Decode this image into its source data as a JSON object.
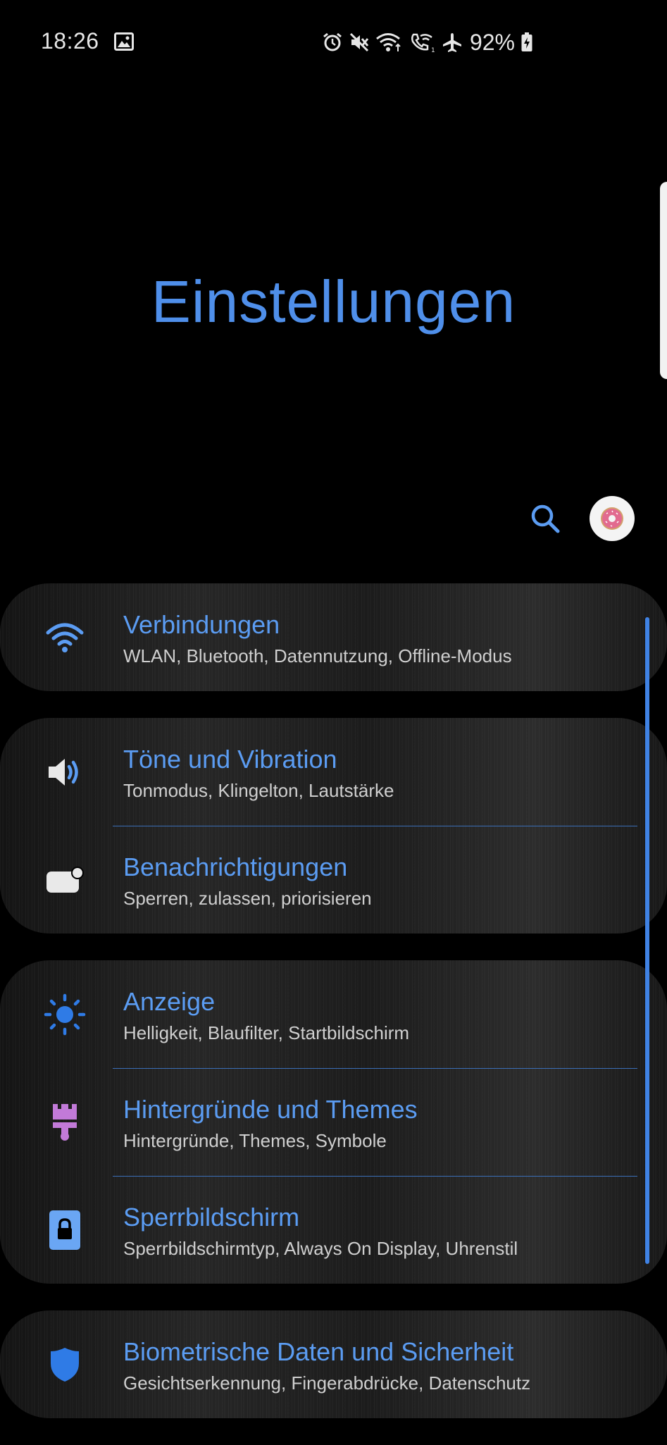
{
  "status_bar": {
    "time": "18:26",
    "battery_percent": "92%",
    "icons": [
      "image-icon",
      "alarm-icon",
      "mute-icon",
      "wifi-icon",
      "wifi-call-icon",
      "airplane-icon",
      "battery-charging-icon"
    ]
  },
  "header": {
    "title": "Einstellungen"
  },
  "colors": {
    "accent": "#5b9cf2",
    "background": "#000000",
    "divider": "#3b6fb8",
    "themes_icon": "#c27ad8"
  },
  "settings": {
    "connections": {
      "title": "Verbindungen",
      "subtitle": "WLAN, Bluetooth, Datennutzung, Offline-Modus",
      "icon": "wifi-icon"
    },
    "sounds": {
      "title": "Töne und Vibration",
      "subtitle": "Tonmodus, Klingelton, Lautstärke",
      "icon": "speaker-icon"
    },
    "notifications": {
      "title": "Benachrichtigungen",
      "subtitle": "Sperren, zulassen, priorisieren",
      "icon": "notification-icon"
    },
    "display": {
      "title": "Anzeige",
      "subtitle": "Helligkeit, Blaufilter, Startbildschirm",
      "icon": "brightness-icon"
    },
    "themes": {
      "title": "Hintergründe und Themes",
      "subtitle": "Hintergründe, Themes, Symbole",
      "icon": "paintbrush-icon"
    },
    "lockscreen": {
      "title": "Sperrbildschirm",
      "subtitle": "Sperrbildschirmtyp, Always On Display, Uhrenstil",
      "icon": "lock-icon"
    },
    "security": {
      "title": "Biometrische Daten und Sicherheit",
      "subtitle": "Gesichtserkennung, Fingerabdrücke, Datenschutz",
      "icon": "shield-icon"
    }
  }
}
